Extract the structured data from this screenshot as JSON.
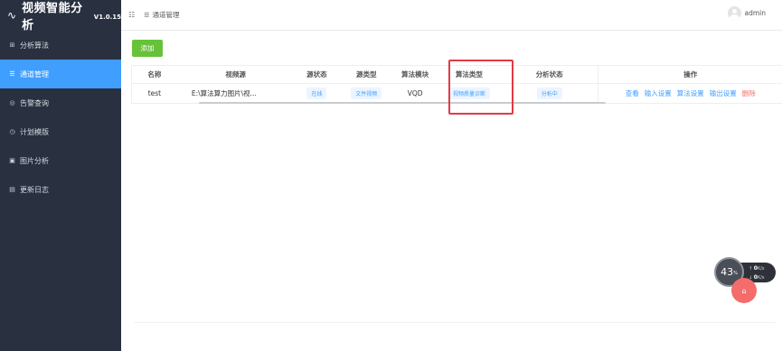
{
  "app": {
    "title": "视频智能分析",
    "version": "V1.0.15"
  },
  "sidebar": {
    "items": [
      {
        "label": "分析算法",
        "icon": "grid-icon",
        "glyph": "⊞",
        "active": false
      },
      {
        "label": "通道管理",
        "icon": "list-icon",
        "glyph": "☰",
        "active": true
      },
      {
        "label": "告警查询",
        "icon": "bell-icon",
        "glyph": "◎",
        "active": false
      },
      {
        "label": "计划模版",
        "icon": "clock-icon",
        "glyph": "◷",
        "active": false
      },
      {
        "label": "图片分析",
        "icon": "image-icon",
        "glyph": "▣",
        "active": false
      },
      {
        "label": "更新日志",
        "icon": "document-icon",
        "glyph": "▤",
        "active": false
      }
    ]
  },
  "header": {
    "breadcrumb": "通道管理",
    "user": "admin"
  },
  "toolbar": {
    "add_label": "添加"
  },
  "table": {
    "columns": [
      "名称",
      "视频源",
      "源状态",
      "源类型",
      "算法模块",
      "算法类型",
      "分析状态",
      "操作"
    ],
    "rows": [
      {
        "name": "test",
        "source": "E:\\算法算力图片\\视...",
        "source_status": "在线",
        "source_type": "文件视频",
        "algo_module": "VQD",
        "algo_type": "视频质量诊断",
        "analysis_status": "分析中",
        "actions": {
          "view": "查看",
          "input": "输入设置",
          "algo": "算法设置",
          "output": "输出设置",
          "delete": "删除"
        }
      }
    ]
  },
  "monitor": {
    "percent": "43",
    "unit": "%",
    "up": "0",
    "down": "0",
    "rate_unit": "K/s"
  },
  "colors": {
    "primary": "#409eff",
    "success": "#67c23a",
    "danger": "#f56c6c",
    "sidebar_bg": "#293140",
    "highlight": "#e33a44"
  }
}
